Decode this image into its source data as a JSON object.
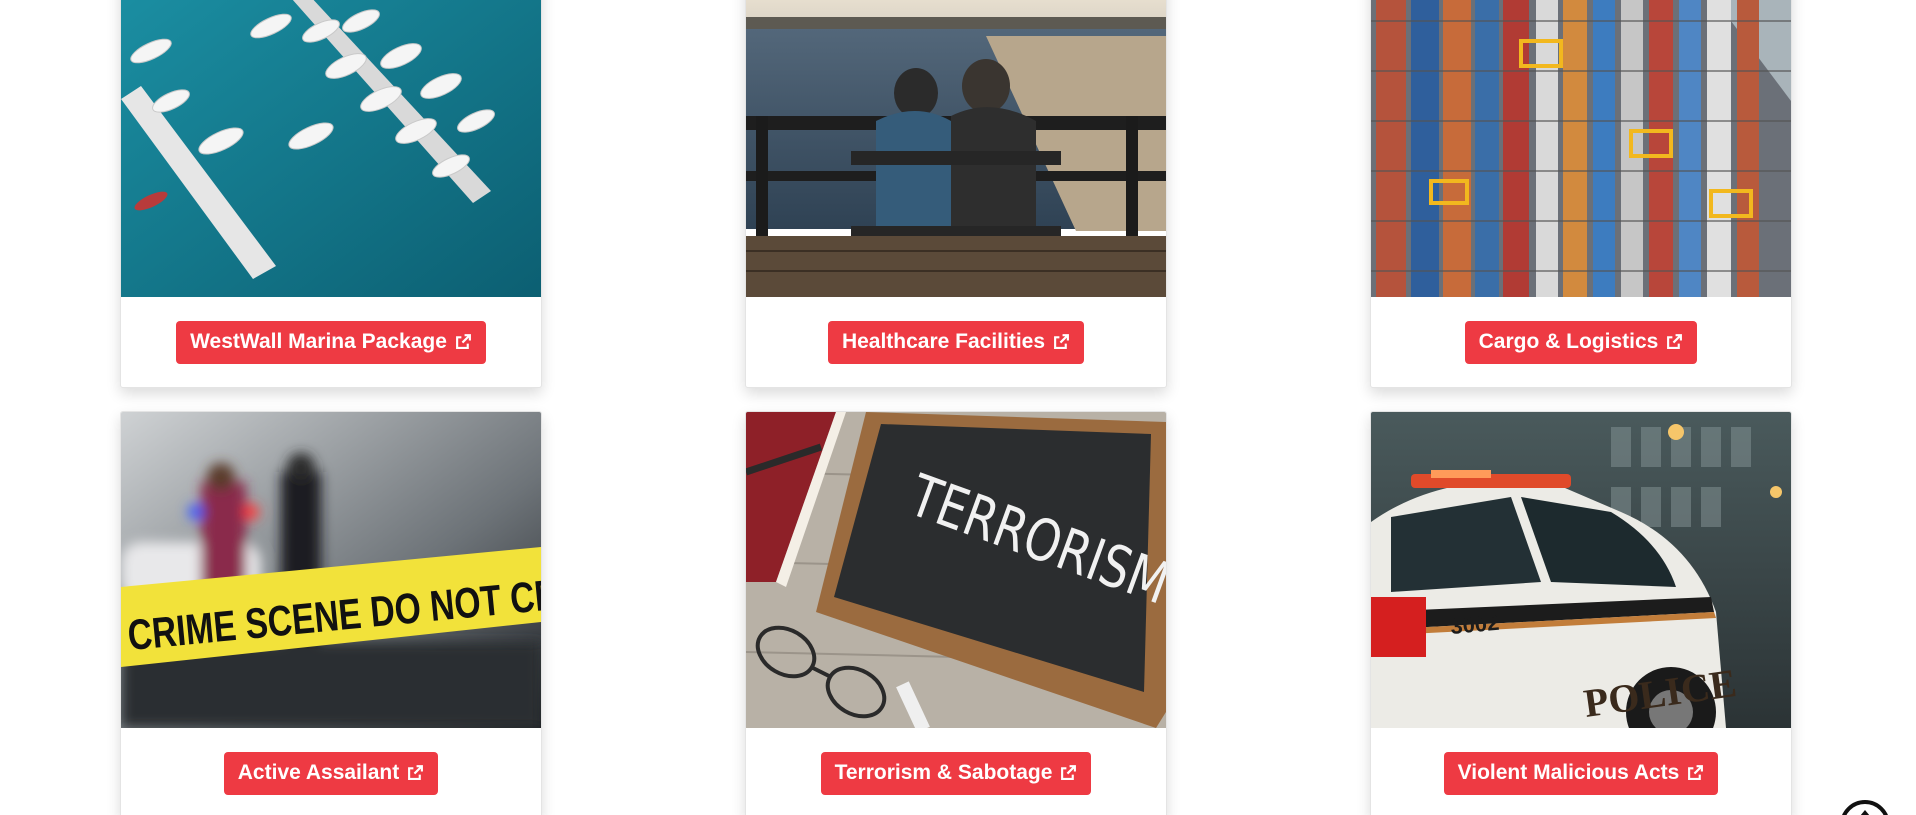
{
  "cards": [
    {
      "label": "WestWall Marina Package",
      "image": "marina-aerial-photo",
      "icon": "external-link-icon"
    },
    {
      "label": "Healthcare Facilities",
      "image": "couple-on-pier-bench-photo",
      "icon": "external-link-icon"
    },
    {
      "label": "Cargo & Logistics",
      "image": "container-port-aerial-photo",
      "icon": "external-link-icon"
    },
    {
      "label": "Active Assailant",
      "image": "crime-scene-tape-photo",
      "icon": "external-link-icon"
    },
    {
      "label": "Terrorism & Sabotage",
      "image": "terrorism-chalkboard-photo",
      "icon": "external-link-icon"
    },
    {
      "label": "Violent Malicious Acts",
      "image": "police-car-photo",
      "icon": "external-link-icon"
    }
  ],
  "photo_text": {
    "crime_tape": "CRIME SCENE DO NOT CRO",
    "chalkboard": "TERRORISM",
    "police_car_word": "POLICE",
    "police_car_number": "3002"
  },
  "colors": {
    "button_red": "#ee3a43",
    "button_text": "#ffffff"
  },
  "scroll_top_icon": "scroll-to-top-icon"
}
